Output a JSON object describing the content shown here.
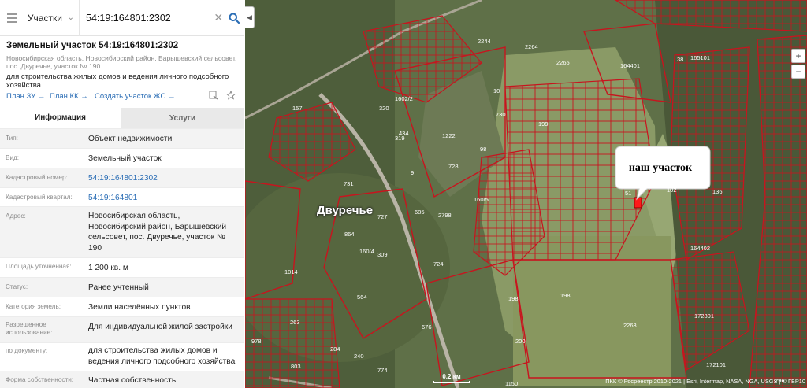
{
  "search": {
    "layer": "Участки",
    "value": "54:19:164801:2302"
  },
  "object": {
    "title": "Земельный участок 54:19:164801:2302",
    "address": "Новосибирская область, Новосибирский район, Барышевский сельсовет, пос. Двуречье, участок № 190",
    "purpose": "для строительства жилых домов и ведения личного подсобного хозяйства"
  },
  "links": {
    "plan_zu": "План ЗУ →",
    "plan_kk": "План КК →",
    "create_zs": "Создать участок ЖС →"
  },
  "tabs": {
    "info": "Информация",
    "services": "Услуги"
  },
  "properties": [
    {
      "label": "Тип:",
      "value": "Объект недвижимости"
    },
    {
      "label": "Вид:",
      "value": "Земельный участок"
    },
    {
      "label": "Кадастровый номер:",
      "value": "54:19:164801:2302"
    },
    {
      "label": "Кадастровый квартал:",
      "value": "54:19:164801"
    },
    {
      "label": "Адрес:",
      "value": "Новосибирская область, Новосибирский район, Барышевский сельсовет, пос. Двуречье, участок № 190"
    },
    {
      "label": "Площадь уточненная:",
      "value": "1 200 кв. м"
    },
    {
      "label": "Статус:",
      "value": "Ранее учтенный"
    },
    {
      "label": "Категория земель:",
      "value": "Земли населённых пунктов"
    },
    {
      "label": "Разрешенное использование:",
      "value": "Для индивидуальной жилой застройки"
    },
    {
      "label": "по документу:",
      "value": "для строительства жилых домов и ведения личного подсобного хозяйства"
    },
    {
      "label": "Форма собственности:",
      "value": "Частная собственность"
    }
  ],
  "map": {
    "callout": "наш участок",
    "village": "Двуречье",
    "scale": "0.2 км",
    "attribution": "ПКК © Росреестр 2010-2021 | Esri, Intermap, NASA, NGA, USGS | © ГБР10",
    "zoom_in": "+",
    "zoom_out": "−",
    "collapse": "◀",
    "parcel_color": "#c8141e",
    "highlight_color": "#ff1a1a",
    "parcel_labels": [
      "2265",
      "2264",
      "2244",
      "38",
      "165101",
      "164401",
      "157",
      "320",
      "1602/2",
      "319",
      "1222",
      "98",
      "730",
      "10",
      "434",
      "9",
      "728",
      "199",
      "51",
      "136",
      "102",
      "731",
      "160/5",
      "685",
      "2798",
      "864",
      "160/4",
      "309",
      "1014",
      "727",
      "724",
      "164402",
      "198",
      "198",
      "564",
      "2263",
      "676",
      "200",
      "172801",
      "978",
      "263",
      "803",
      "284",
      "774",
      "240",
      "1150",
      "172101",
      "296"
    ]
  }
}
